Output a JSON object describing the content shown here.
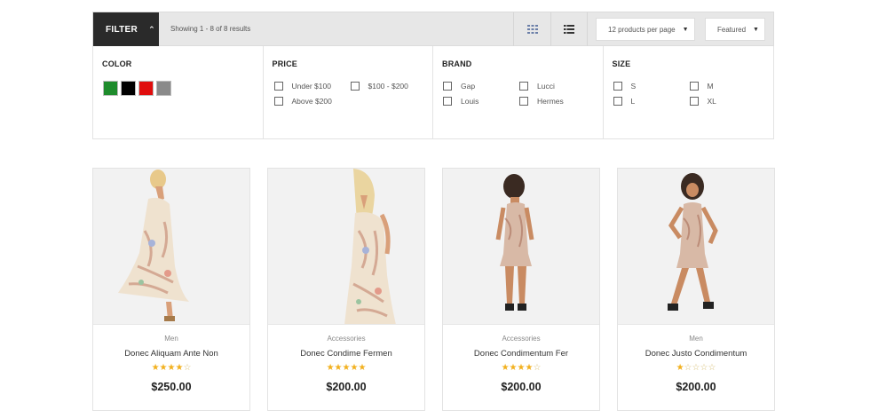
{
  "toolbar": {
    "filter_label": "FILTER",
    "filter_chevron": "^",
    "showing": "Showing 1 - 8 of 8 results",
    "grid_icon": "grid-view-icon",
    "list_icon": "list-view-icon",
    "per_page": "12 products per page",
    "sort": "Featured"
  },
  "filters": {
    "color": {
      "title": "COLOR",
      "swatches": [
        "#1e8c2c",
        "#000000",
        "#e00d0d",
        "#8a8a8a"
      ]
    },
    "price": {
      "title": "PRICE",
      "options": [
        "Under $100",
        "$100 - $200",
        "Above $200"
      ]
    },
    "brand": {
      "title": "BRAND",
      "options": [
        "Gap",
        "Lucci",
        "Louis",
        "Hermes"
      ]
    },
    "size": {
      "title": "SIZE",
      "options": [
        "S",
        "M",
        "L",
        "XL"
      ]
    }
  },
  "products": [
    {
      "category": "Men",
      "name": "Donec Aliquam Ante Non",
      "rating": 4,
      "price": "$250.00"
    },
    {
      "category": "Accessories",
      "name": "Donec Condime Fermen",
      "rating": 5,
      "price": "$200.00"
    },
    {
      "category": "Accessories",
      "name": "Donec Condimentum Fer",
      "rating": 4,
      "price": "$200.00"
    },
    {
      "category": "Men",
      "name": "Donec Justo Condimentum",
      "rating": 1,
      "price": "$200.00"
    }
  ],
  "colors": {
    "star": "#f2b01e",
    "toolbar_dark": "#2a2a2a",
    "toolbar_bg": "#e7e7e7"
  }
}
